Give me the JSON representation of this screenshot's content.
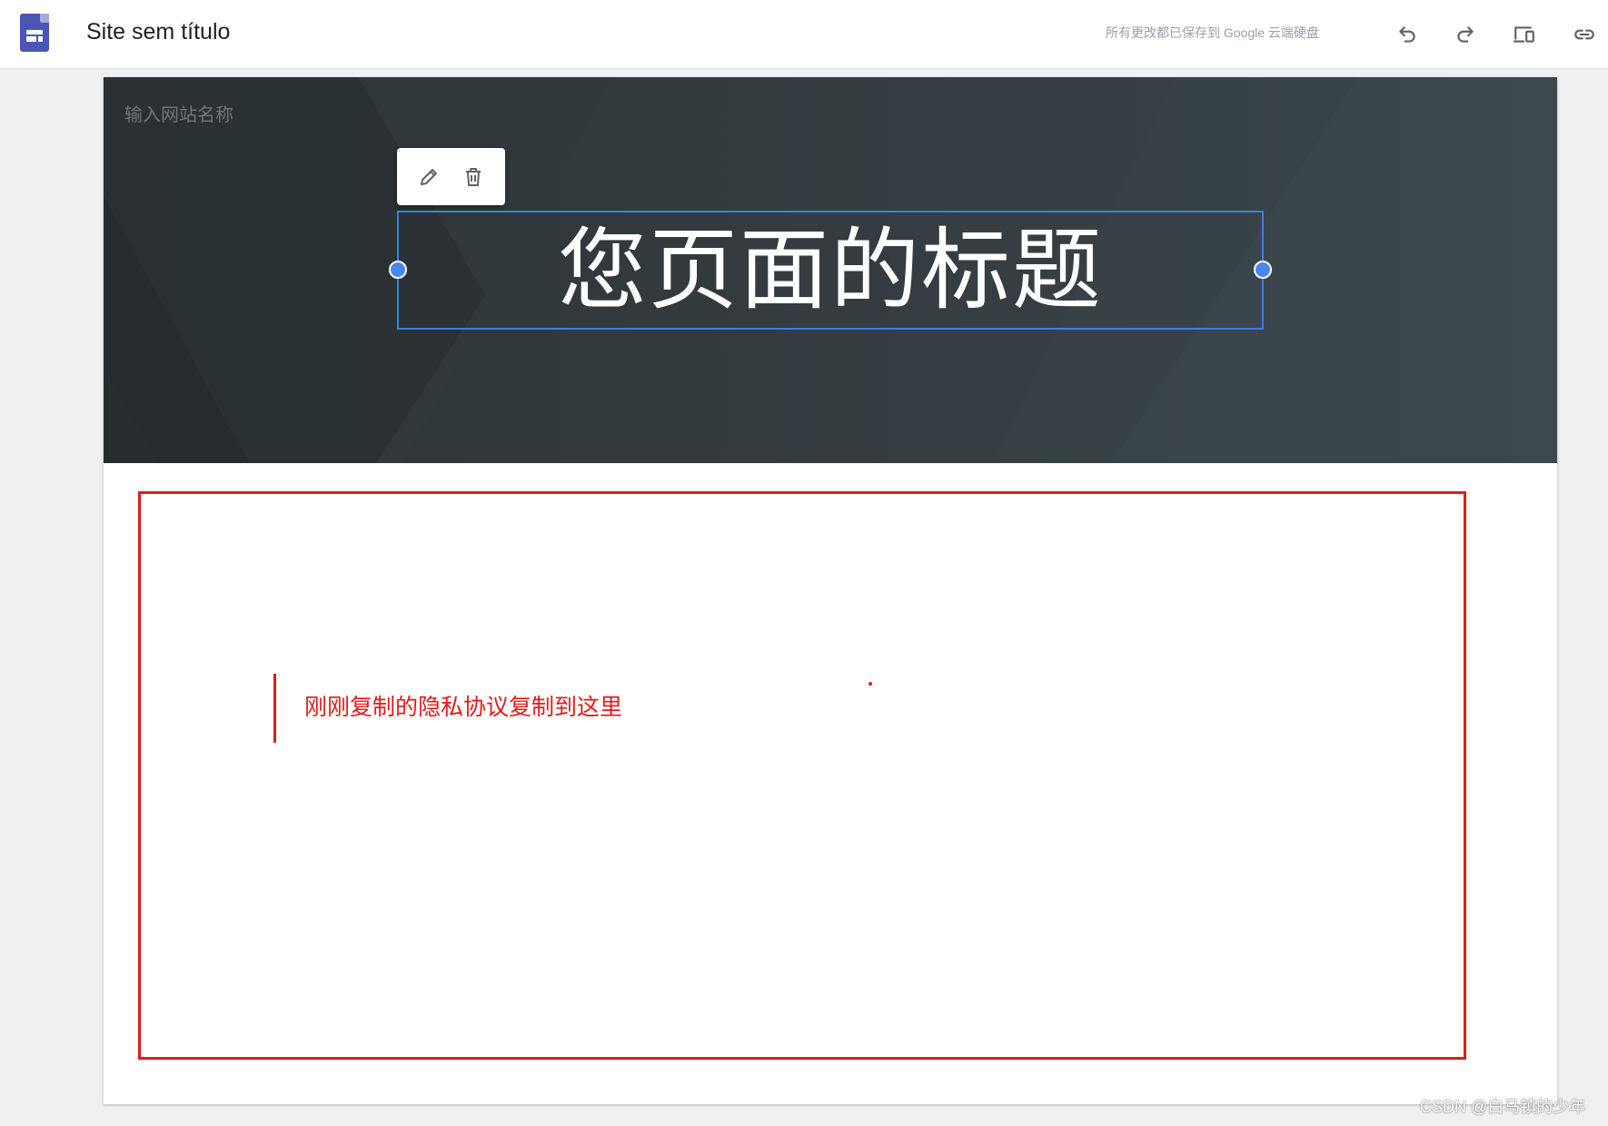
{
  "app": {
    "logo_icon": "google-sites-logo-icon",
    "document_title": "Site sem título",
    "save_status": "所有更改都已保存到 Google 云端硬盘"
  },
  "toolbar": {
    "undo_icon": "undo-icon",
    "redo_icon": "redo-icon",
    "preview_icon": "devices-preview-icon",
    "link_icon": "link-icon"
  },
  "header": {
    "site_name_placeholder": "输入网站名称",
    "page_title": "您页面的标题",
    "edit_icon": "pencil-icon",
    "delete_icon": "trash-icon",
    "selection_color": "#3f7fe0"
  },
  "annotation": {
    "note_text": "刚刚复制的隐私协议复制到这里",
    "color": "#e11b1b"
  },
  "watermark": {
    "text": "CSDN @白马镇的少年"
  }
}
